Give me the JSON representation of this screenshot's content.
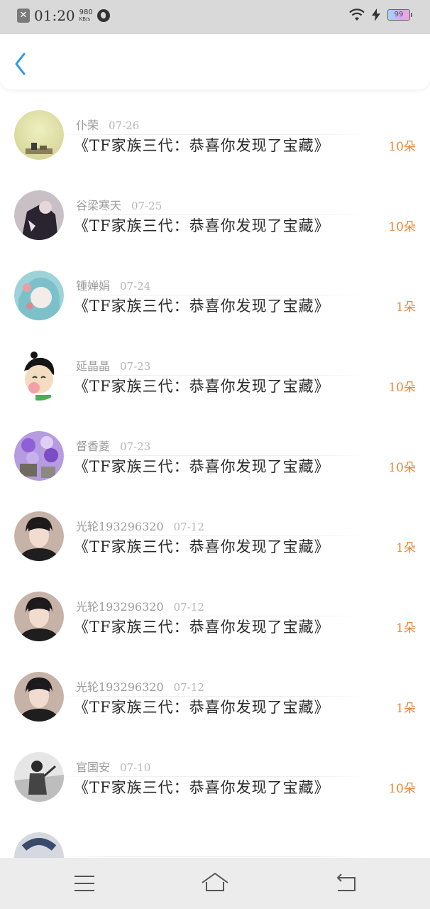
{
  "status_bar": {
    "time": "01:20",
    "net_speed": "980",
    "net_unit": "KB/s",
    "battery": "99"
  },
  "colors": {
    "accent": "#2a9be8",
    "amount": "#e8873a",
    "status_bar_bg": "#d9d9d9"
  },
  "list": {
    "items": [
      {
        "name": "",
        "date": "",
        "title": "",
        "amount": "",
        "avatar_icon": "green-avatar"
      },
      {
        "name": "仆荣",
        "date": "07-26",
        "title": "《TF家族三代：恭喜你发现了宝藏》",
        "amount": "10朵",
        "avatar_icon": "landscape-avatar"
      },
      {
        "name": "谷梁寒天",
        "date": "07-25",
        "title": "《TF家族三代：恭喜你发现了宝藏》",
        "amount": "10朵",
        "avatar_icon": "dark-figure-avatar"
      },
      {
        "name": "锺婵娟",
        "date": "07-24",
        "title": "《TF家族三代：恭喜你发现了宝藏》",
        "amount": "1朵",
        "avatar_icon": "anime-avatar"
      },
      {
        "name": "延晶晶",
        "date": "07-23",
        "title": "《TF家族三代：恭喜你发现了宝藏》",
        "amount": "10朵",
        "avatar_icon": "cartoon-avatar"
      },
      {
        "name": "督香菱",
        "date": "07-23",
        "title": "《TF家族三代：恭喜你发现了宝藏》",
        "amount": "10朵",
        "avatar_icon": "purple-flowers-avatar"
      },
      {
        "name": "光轮193296320",
        "date": "07-12",
        "title": "《TF家族三代：恭喜你发现了宝藏》",
        "amount": "1朵",
        "avatar_icon": "boy-avatar"
      },
      {
        "name": "光轮193296320",
        "date": "07-12",
        "title": "《TF家族三代：恭喜你发现了宝藏》",
        "amount": "1朵",
        "avatar_icon": "boy-avatar"
      },
      {
        "name": "光轮193296320",
        "date": "07-12",
        "title": "《TF家族三代：恭喜你发现了宝藏》",
        "amount": "1朵",
        "avatar_icon": "boy-avatar"
      },
      {
        "name": "官国安",
        "date": "07-10",
        "title": "《TF家族三代：恭喜你发现了宝藏》",
        "amount": "10朵",
        "avatar_icon": "bw-photo-avatar"
      },
      {
        "name": "",
        "date": "",
        "title": "",
        "amount": "",
        "avatar_icon": "partial-avatar"
      }
    ]
  },
  "nav_bar": {
    "menu_icon": "menu-icon",
    "home_icon": "home-icon",
    "back_icon": "return-icon"
  }
}
